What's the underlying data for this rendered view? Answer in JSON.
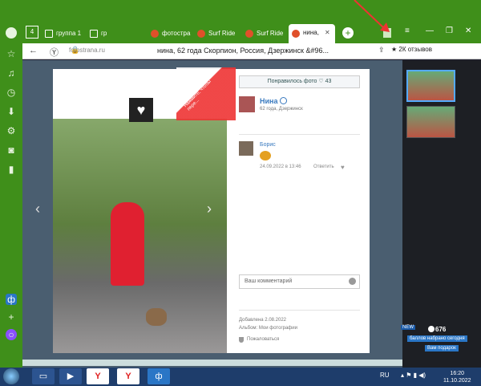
{
  "tabs": [
    {
      "label": "группа 1"
    },
    {
      "label": "гр"
    },
    {
      "label": "фотостра"
    },
    {
      "label": "Surf Ride"
    },
    {
      "label": "Surf Ride"
    },
    {
      "label": "нина, "
    }
  ],
  "address": {
    "url": "fotostrana.ru",
    "title": "нина, 62 года Скорпион, Россия, Дзержинск &#96...",
    "reviews": "★ 2К отзывов"
  },
  "photo_panel": {
    "like_label": "Понравилось фото  ♡ 43",
    "user_name": "Нина",
    "user_info": "62 года, Дзержинск",
    "commenter": "Борис",
    "comment_date": "24.09.2022 в 13:46",
    "reply_label": "Ответить",
    "comment_placeholder": "Ваш комментарий",
    "added_date": "Добавлена 2.08.2022",
    "album": "Альбом: Мои фотографии",
    "complain": "Пожаловаться",
    "sticker_text": "Нажмите, чтобы пере..."
  },
  "rewards": {
    "new_badge": "NEW",
    "points": "676",
    "points_label": "баллов набрано сегодня",
    "gift_label": "Вам подарок"
  },
  "taskbar": {
    "lang": "RU",
    "time": "16:20",
    "date": "11.10.2022"
  },
  "colors": {
    "browser_green": "#3f8f1a",
    "link_blue": "#3a7abf",
    "taskbar": "#1e3d6b"
  }
}
